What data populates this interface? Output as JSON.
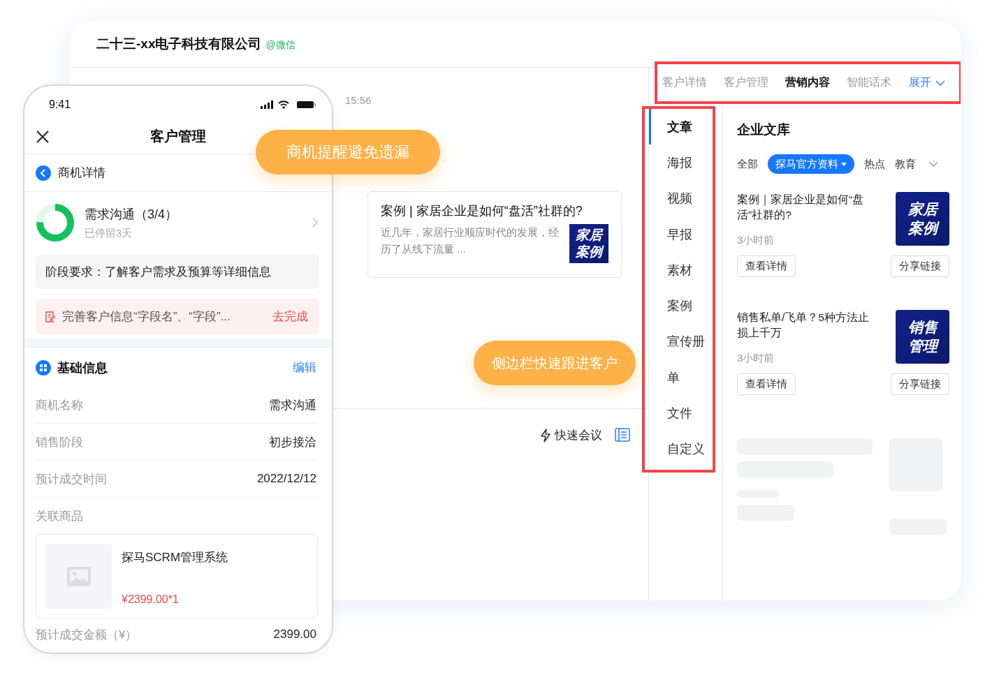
{
  "company": {
    "name": "二十三-xx电子科技有限公司",
    "channel": "@微信"
  },
  "chat": {
    "time": "15:56",
    "card": {
      "title": "案例 | 家居企业是如何“盘活”社群的?",
      "summary": "近几年，家居行业顺应时代的发展，经历了从线下流量 ...",
      "thumb": [
        "家居",
        "案例"
      ]
    },
    "meeting": "快速会议"
  },
  "panel_tabs": [
    {
      "label": "客户详情",
      "selected": false
    },
    {
      "label": "客户管理",
      "selected": false
    },
    {
      "label": "营销内容",
      "selected": true
    },
    {
      "label": "智能话术",
      "selected": false
    }
  ],
  "expand": "展开",
  "sidebar": {
    "items": [
      {
        "label": "文章",
        "selected": true
      },
      {
        "label": "海报",
        "selected": false
      },
      {
        "label": "视频",
        "selected": false
      },
      {
        "label": "早报",
        "selected": false
      },
      {
        "label": "素材",
        "selected": false
      },
      {
        "label": "案例",
        "selected": false
      },
      {
        "label": "宣传册",
        "selected": false
      },
      {
        "label": "单",
        "selected": false
      },
      {
        "label": "文件",
        "selected": false
      },
      {
        "label": "自定义",
        "selected": false
      }
    ]
  },
  "library": {
    "title": "企业文库",
    "filters": [
      {
        "label": "全部",
        "selected": false
      },
      {
        "label": "探马官方资料",
        "selected": true
      },
      {
        "label": "热点",
        "selected": false
      },
      {
        "label": "教育",
        "selected": false
      }
    ],
    "articles": [
      {
        "title": "案例｜家居企业是如何“盘活”社群的?",
        "time": "3小时前",
        "thumb": [
          "家居",
          "案例"
        ],
        "view": "查看详情",
        "share": "分享链接"
      },
      {
        "title": "销售私单/飞单？5种方法止损上千万",
        "time": "3小时前",
        "thumb": [
          "销售",
          "管理"
        ],
        "view": "查看详情",
        "share": "分享链接"
      }
    ]
  },
  "callouts": [
    "商机提醒避免遗漏",
    "侧边栏快速跟进客户"
  ],
  "phone": {
    "time": "9:41",
    "title": "客户管理",
    "back": "商机详情",
    "stage": {
      "name": "需求沟通（3/4）",
      "stay": "已停留3天",
      "level": 0.75
    },
    "requirement": "阶段要求：了解客户需求及预算等详细信息",
    "task": {
      "text": "完善客户信息“字段名”、“字段”...",
      "action": "去完成"
    },
    "basic": {
      "title": "基础信息",
      "edit": "编辑",
      "fields": [
        {
          "label": "商机名称",
          "value": "需求沟通"
        },
        {
          "label": "销售阶段",
          "value": "初步接洽"
        },
        {
          "label": "预计成交时间",
          "value": "2022/12/12"
        }
      ]
    },
    "products_label": "关联商品",
    "product": {
      "name": "探马SCRM管理系统",
      "price": "¥2399.00*1"
    },
    "amount": {
      "label": "预计成交金额（¥）",
      "value": "2399.00"
    }
  }
}
